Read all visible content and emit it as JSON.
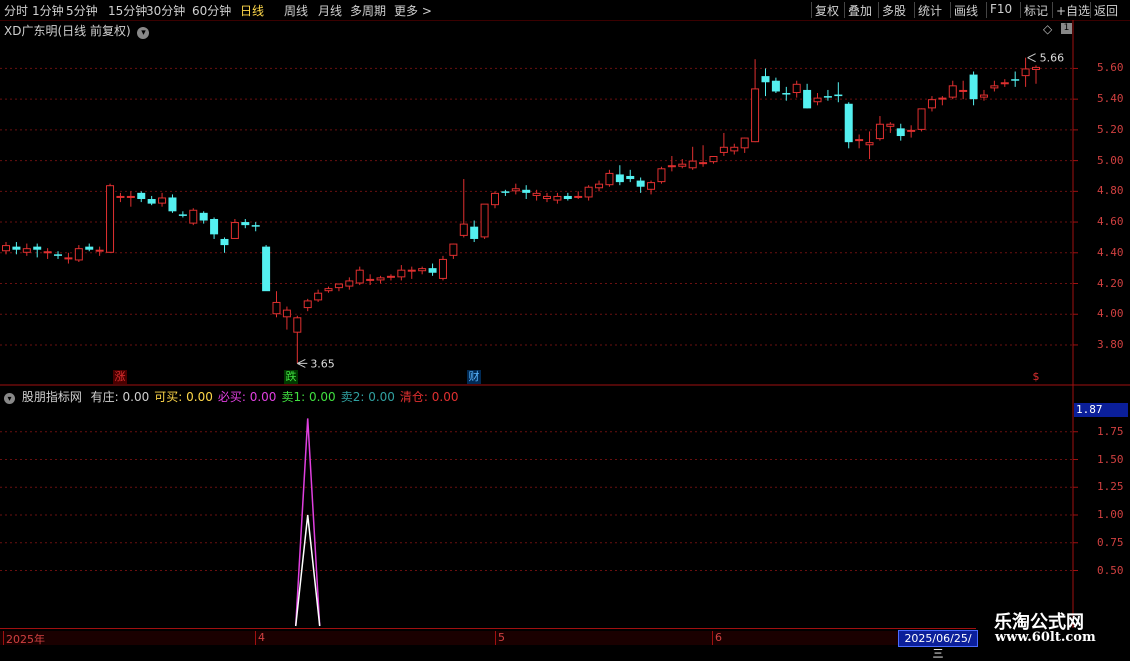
{
  "toolbar": {
    "left": [
      {
        "label": "分时",
        "active": false
      },
      {
        "label": "1分钟",
        "active": false
      },
      {
        "label": "5分钟",
        "active": false
      },
      {
        "label": "15分钟",
        "active": false
      },
      {
        "label": "30分钟",
        "active": false
      },
      {
        "label": "60分钟",
        "active": false
      },
      {
        "label": "日线",
        "active": true
      },
      {
        "label": "周线",
        "active": false
      },
      {
        "label": "月线",
        "active": false
      },
      {
        "label": "多周期",
        "active": false
      },
      {
        "label": "更多 >",
        "active": false
      }
    ],
    "right": [
      "复权",
      "叠加",
      "多股",
      "统计",
      "画线",
      "F10",
      "标记",
      "+自选",
      "返回"
    ]
  },
  "main_panel": {
    "title": "XD广东明(日线 前复权)",
    "y_ticks": [
      "5.60",
      "5.40",
      "5.20",
      "5.00",
      "4.80",
      "4.60",
      "4.40",
      "4.20",
      "4.00",
      "3.80"
    ],
    "high_label": "5.66",
    "low_label": "3.65",
    "events": [
      {
        "text": "涨",
        "color": "#e03030",
        "bg": "#4a0000"
      },
      {
        "text": "跌",
        "color": "#40e040",
        "bg": "#003a00"
      },
      {
        "text": "财",
        "color": "#57b4ff",
        "bg": "#002a55"
      },
      {
        "text": "$",
        "color": "#e03030",
        "bg": "#000"
      }
    ]
  },
  "indicator_panel": {
    "name": "股朋指标网",
    "fields": [
      {
        "label": "有庄:",
        "value": "0.00",
        "color": "#d0d0d0"
      },
      {
        "label": "可买:",
        "value": "0.00",
        "color": "#ffd84a"
      },
      {
        "label": "必买:",
        "value": "0.00",
        "color": "#e040e0"
      },
      {
        "label": "卖1:",
        "value": "0.00",
        "color": "#40e040"
      },
      {
        "label": "卖2:",
        "value": "0.00",
        "color": "#30a0a0"
      },
      {
        "label": "清仓:",
        "value": "0.00",
        "color": "#e03030"
      }
    ],
    "y_ticks": [
      "1.75",
      "1.50",
      "1.25",
      "1.00",
      "0.75",
      "0.50"
    ],
    "current_value": "1.87"
  },
  "date_axis": {
    "labels": [
      "2025年",
      "4",
      "5",
      "6"
    ],
    "current_date": "2025/06/25/三"
  },
  "watermark": {
    "cn": "乐淘公式网",
    "en": "www.60lt.com"
  },
  "colors": {
    "up": "#e03030",
    "down": "#54f0f0",
    "grid": "#7a1010",
    "accent": "#ffd84a"
  },
  "chart_data": {
    "type": "candlestick",
    "ylim": [
      3.65,
      5.72
    ],
    "ohlc": [
      [
        4.41,
        4.47,
        4.39,
        4.45
      ],
      [
        4.44,
        4.47,
        4.39,
        4.42
      ],
      [
        4.4,
        4.46,
        4.38,
        4.43
      ],
      [
        4.44,
        4.46,
        4.37,
        4.42
      ],
      [
        4.4,
        4.43,
        4.36,
        4.41
      ],
      [
        4.39,
        4.41,
        4.36,
        4.38
      ],
      [
        4.36,
        4.4,
        4.33,
        4.37
      ],
      [
        4.35,
        4.45,
        4.34,
        4.43
      ],
      [
        4.44,
        4.46,
        4.41,
        4.42
      ],
      [
        4.41,
        4.44,
        4.38,
        4.42
      ],
      [
        4.4,
        4.85,
        4.4,
        4.84
      ],
      [
        4.77,
        4.79,
        4.73,
        4.77
      ],
      [
        4.77,
        4.8,
        4.7,
        4.77
      ],
      [
        4.79,
        4.8,
        4.73,
        4.75
      ],
      [
        4.75,
        4.77,
        4.71,
        4.72
      ],
      [
        4.72,
        4.79,
        4.7,
        4.76
      ],
      [
        4.76,
        4.78,
        4.66,
        4.67
      ],
      [
        4.65,
        4.67,
        4.63,
        4.64
      ],
      [
        4.59,
        4.69,
        4.58,
        4.68
      ],
      [
        4.66,
        4.67,
        4.59,
        4.61
      ],
      [
        4.62,
        4.63,
        4.49,
        4.52
      ],
      [
        4.49,
        4.5,
        4.4,
        4.45
      ],
      [
        4.49,
        4.62,
        4.49,
        4.6
      ],
      [
        4.6,
        4.62,
        4.56,
        4.58
      ],
      [
        4.58,
        4.6,
        4.54,
        4.57
      ],
      [
        4.44,
        4.45,
        4.31,
        4.15
      ],
      [
        4.0,
        4.15,
        3.98,
        4.08
      ],
      [
        3.98,
        4.05,
        3.9,
        4.03
      ],
      [
        3.88,
        3.99,
        3.68,
        3.98
      ],
      [
        4.04,
        4.1,
        4.02,
        4.09
      ],
      [
        4.09,
        4.16,
        4.08,
        4.14
      ],
      [
        4.15,
        4.18,
        4.14,
        4.17
      ],
      [
        4.17,
        4.2,
        4.15,
        4.2
      ],
      [
        4.18,
        4.24,
        4.16,
        4.22
      ],
      [
        4.2,
        4.31,
        4.19,
        4.29
      ],
      [
        4.23,
        4.26,
        4.19,
        4.23
      ],
      [
        4.22,
        4.25,
        4.2,
        4.24
      ],
      [
        4.24,
        4.26,
        4.22,
        4.25
      ],
      [
        4.24,
        4.32,
        4.22,
        4.29
      ],
      [
        4.28,
        4.31,
        4.23,
        4.29
      ],
      [
        4.28,
        4.31,
        4.26,
        4.3
      ],
      [
        4.3,
        4.33,
        4.25,
        4.27
      ],
      [
        4.23,
        4.38,
        4.22,
        4.36
      ],
      [
        4.38,
        4.46,
        4.36,
        4.46
      ],
      [
        4.51,
        4.88,
        4.5,
        4.59
      ],
      [
        4.57,
        4.61,
        4.47,
        4.49
      ],
      [
        4.5,
        4.71,
        4.49,
        4.72
      ],
      [
        4.71,
        4.8,
        4.69,
        4.79
      ],
      [
        4.8,
        4.81,
        4.77,
        4.79
      ],
      [
        4.8,
        4.85,
        4.78,
        4.82
      ],
      [
        4.81,
        4.84,
        4.75,
        4.79
      ],
      [
        4.77,
        4.81,
        4.74,
        4.79
      ],
      [
        4.75,
        4.79,
        4.73,
        4.77
      ],
      [
        4.74,
        4.79,
        4.72,
        4.77
      ],
      [
        4.77,
        4.79,
        4.74,
        4.75
      ],
      [
        4.77,
        4.8,
        4.75,
        4.77
      ],
      [
        4.76,
        4.84,
        4.74,
        4.83
      ],
      [
        4.82,
        4.87,
        4.8,
        4.85
      ],
      [
        4.84,
        4.94,
        4.83,
        4.92
      ],
      [
        4.91,
        4.97,
        4.84,
        4.86
      ],
      [
        4.9,
        4.94,
        4.86,
        4.88
      ],
      [
        4.87,
        4.89,
        4.79,
        4.83
      ],
      [
        4.81,
        4.87,
        4.78,
        4.86
      ],
      [
        4.86,
        4.96,
        4.85,
        4.95
      ],
      [
        4.96,
        5.03,
        4.93,
        4.97
      ],
      [
        4.96,
        5.01,
        4.95,
        4.98
      ],
      [
        4.95,
        5.09,
        4.94,
        5.0
      ],
      [
        4.98,
        5.1,
        4.96,
        4.99
      ],
      [
        4.99,
        5.03,
        4.98,
        5.03
      ],
      [
        5.05,
        5.18,
        5.03,
        5.09
      ],
      [
        5.06,
        5.11,
        5.04,
        5.09
      ],
      [
        5.08,
        5.15,
        5.05,
        5.15
      ],
      [
        5.12,
        5.66,
        5.12,
        5.47
      ],
      [
        5.55,
        5.6,
        5.42,
        5.51
      ],
      [
        5.52,
        5.54,
        5.44,
        5.45
      ],
      [
        5.44,
        5.48,
        5.39,
        5.43
      ],
      [
        5.44,
        5.52,
        5.41,
        5.5
      ],
      [
        5.46,
        5.5,
        5.34,
        5.34
      ],
      [
        5.38,
        5.44,
        5.36,
        5.41
      ],
      [
        5.42,
        5.46,
        5.39,
        5.41
      ],
      [
        5.43,
        5.51,
        5.38,
        5.42
      ],
      [
        5.37,
        5.38,
        5.08,
        5.12
      ],
      [
        5.13,
        5.17,
        5.08,
        5.14
      ],
      [
        5.1,
        5.19,
        5.01,
        5.12
      ],
      [
        5.14,
        5.29,
        5.13,
        5.24
      ],
      [
        5.22,
        5.25,
        5.18,
        5.24
      ],
      [
        5.21,
        5.24,
        5.13,
        5.16
      ],
      [
        5.19,
        5.23,
        5.15,
        5.2
      ],
      [
        5.2,
        5.34,
        5.19,
        5.34
      ],
      [
        5.34,
        5.42,
        5.32,
        5.4
      ],
      [
        5.4,
        5.42,
        5.36,
        5.41
      ],
      [
        5.41,
        5.52,
        5.4,
        5.49
      ],
      [
        5.45,
        5.52,
        5.4,
        5.46
      ],
      [
        5.56,
        5.58,
        5.36,
        5.4
      ],
      [
        5.41,
        5.46,
        5.39,
        5.43
      ],
      [
        5.47,
        5.52,
        5.45,
        5.49
      ],
      [
        5.51,
        5.53,
        5.48,
        5.51
      ],
      [
        5.53,
        5.58,
        5.48,
        5.52
      ],
      [
        5.55,
        5.67,
        5.48,
        5.6
      ],
      [
        5.59,
        5.62,
        5.5,
        5.61
      ]
    ],
    "indicator_series": [
      {
        "color": "#e040e0",
        "spike_index": 29,
        "value": 1.87
      },
      {
        "color": "#ffffff",
        "spike_index": 29,
        "value": 1.0
      }
    ]
  }
}
